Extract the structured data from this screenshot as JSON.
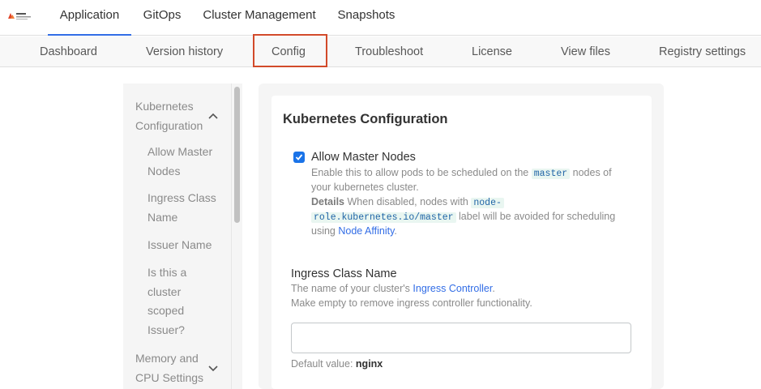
{
  "logo_text": "replicated software",
  "top_tabs": [
    "Application",
    "GitOps",
    "Cluster Management",
    "Snapshots"
  ],
  "sub_tabs": [
    "Dashboard",
    "Version history",
    "Config",
    "Troubleshoot",
    "License",
    "View files",
    "Registry settings"
  ],
  "sidebar": {
    "group1": "Kubernetes Configuration",
    "items": [
      "Allow Master Nodes",
      "Ingress Class Name",
      "Issuer Name",
      "Is this a cluster scoped Issuer?"
    ],
    "group2": "Memory and CPU Settings"
  },
  "main": {
    "title": "Kubernetes Configuration",
    "allow_master": {
      "label": "Allow Master Nodes",
      "help_pre": "Enable this to allow pods to be scheduled on the",
      "help_code": "master",
      "help_post": "nodes of",
      "help_line2": "your kubernetes cluster.",
      "details_label": "Details",
      "details_pre": "When disabled, nodes with",
      "details_code1": "node-",
      "details_code2": "role.kubernetes.io/master",
      "details_post": "label will be avoided for scheduling",
      "details_line3_pre": "using",
      "details_link": "Node Affinity",
      "details_line3_post": "."
    },
    "ingress": {
      "label": "Ingress Class Name",
      "help_pre": "The name of your cluster's",
      "help_link": "Ingress Controller",
      "help_post": ".",
      "help_line2": "Make empty to remove ingress controller functionality.",
      "value": "",
      "placeholder": "",
      "default_label": "Default value:",
      "default_value": "nginx"
    }
  },
  "colors": {
    "accent": "#326de6",
    "highlight": "#d24a2a",
    "code_bg": "#e9f6f1"
  },
  "icons": [
    "chevron-up-icon",
    "chevron-down-icon",
    "check-icon"
  ]
}
